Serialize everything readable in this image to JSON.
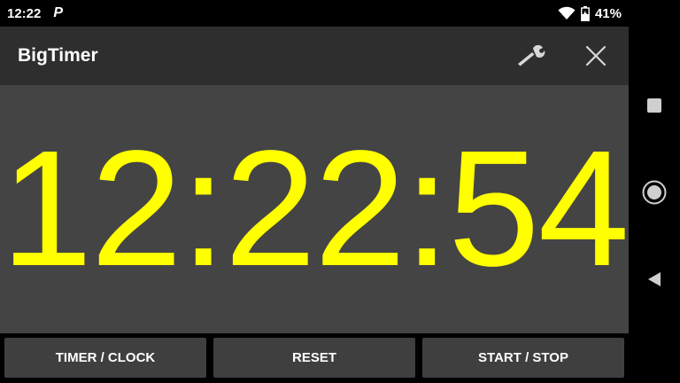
{
  "status_bar": {
    "time": "12:22",
    "battery_percent": "41%",
    "icons": [
      "parking-app-icon",
      "wifi-icon",
      "battery-charging-icon"
    ]
  },
  "app_bar": {
    "title": "BigTimer",
    "icons": [
      "wrench-icon",
      "close-icon"
    ]
  },
  "clock": {
    "display": "12:22:54",
    "color": "#ffff00",
    "background": "#444444"
  },
  "buttons": {
    "timer_clock": "TIMER / CLOCK",
    "reset": "RESET",
    "start_stop": "START / STOP"
  },
  "nav_bar": {
    "icons": [
      "recents-square-icon",
      "home-circle-icon",
      "back-triangle-icon"
    ]
  }
}
